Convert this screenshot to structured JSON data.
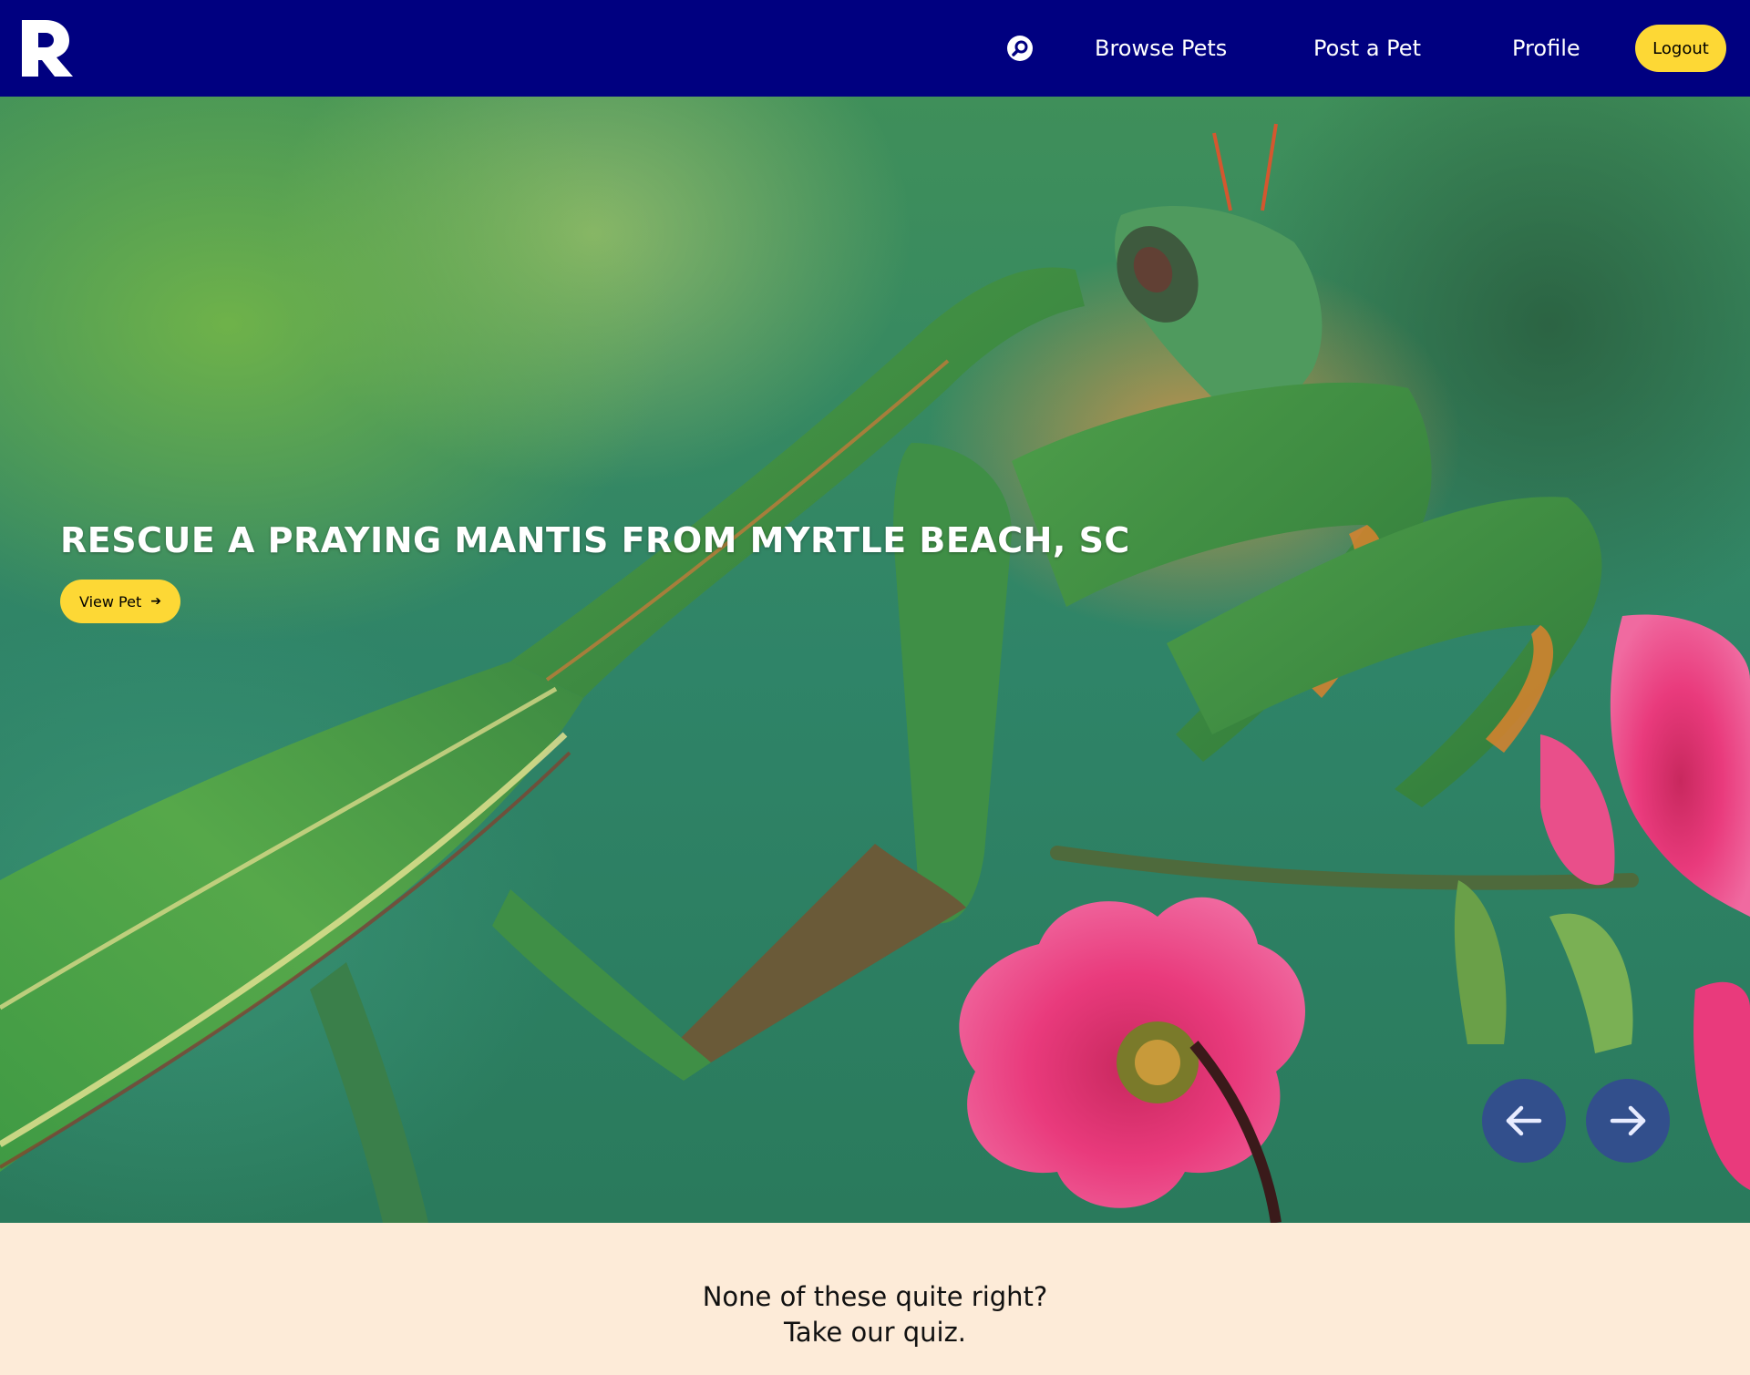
{
  "nav": {
    "logo_alt": "R",
    "search_icon": "search-icon",
    "links": {
      "browse": "Browse Pets",
      "post": "Post a Pet",
      "profile": "Profile"
    },
    "logout_label": "Logout"
  },
  "hero": {
    "caption": "RESCUE A PRAYING MANTIS FROM MYRTLE BEACH, SC",
    "view_pet_label": "View Pet",
    "view_pet_icon": "arrow-right-icon",
    "prev_icon": "arrow-left-icon",
    "next_icon": "arrow-right-icon"
  },
  "quiz": {
    "line1": "None of these quite right?",
    "line2": "Take our quiz."
  },
  "colors": {
    "navbar": "#000080",
    "accent_yellow": "#fdd835",
    "footer_bg": "#fdebd8",
    "carousel_btn": "#344696"
  }
}
